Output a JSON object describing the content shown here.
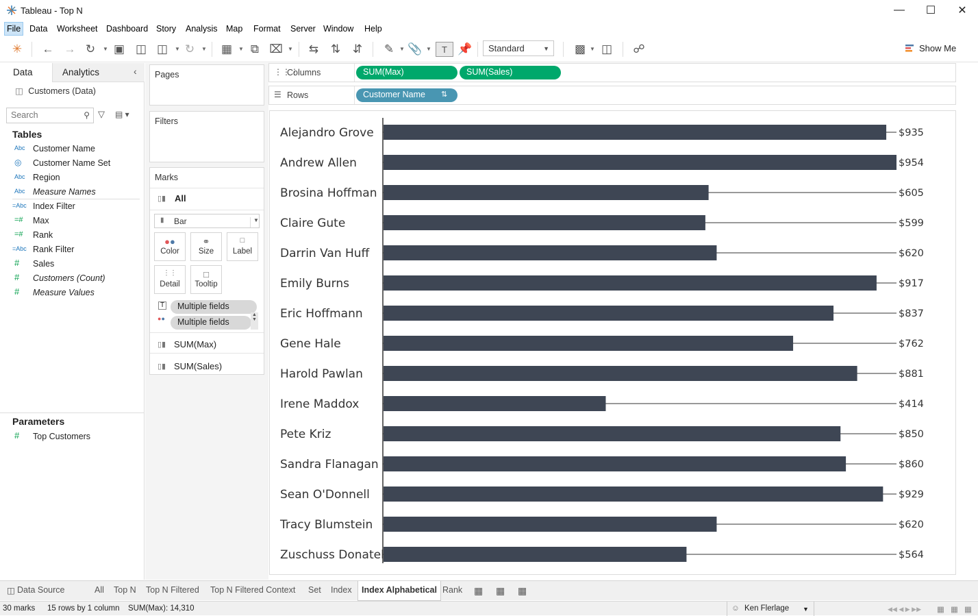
{
  "window": {
    "title": "Tableau - Top N"
  },
  "menu": [
    "File",
    "Data",
    "Worksheet",
    "Dashboard",
    "Story",
    "Analysis",
    "Map",
    "Format",
    "Server",
    "Window",
    "Help"
  ],
  "toolbar": {
    "fit_value": "Standard",
    "show_me": "Show Me"
  },
  "left": {
    "tab_data": "Data",
    "tab_analytics": "Analytics",
    "datasource": "Customers (Data)",
    "search_placeholder": "Search",
    "tables_header": "Tables",
    "fields": [
      {
        "icon": "Abc",
        "name": "Customer Name",
        "italic": false
      },
      {
        "icon": "set",
        "name": "Customer Name Set",
        "italic": false
      },
      {
        "icon": "Abc",
        "name": "Region",
        "italic": false
      },
      {
        "icon": "Abc",
        "name": "Measure Names",
        "italic": true
      },
      {
        "icon": "=Abc",
        "name": "Index Filter",
        "italic": false
      },
      {
        "icon": "=#",
        "name": "Max",
        "italic": false
      },
      {
        "icon": "=#",
        "name": "Rank",
        "italic": false
      },
      {
        "icon": "=Abc",
        "name": "Rank Filter",
        "italic": false
      },
      {
        "icon": "#",
        "name": "Sales",
        "italic": false
      },
      {
        "icon": "#",
        "name": "Customers (Count)",
        "italic": true
      },
      {
        "icon": "#",
        "name": "Measure Values",
        "italic": true
      }
    ],
    "parameters_header": "Parameters",
    "parameters": [
      {
        "icon": "#",
        "name": "Top Customers"
      }
    ]
  },
  "shelves": {
    "pages": "Pages",
    "filters": "Filters",
    "marks": "Marks",
    "marks_all": "All",
    "mark_type": "Bar",
    "buttons": {
      "color": "Color",
      "size": "Size",
      "label": "Label",
      "detail": "Detail",
      "tooltip": "Tooltip"
    },
    "mark_fields": [
      "Multiple fields",
      "Multiple fields"
    ],
    "measures": [
      "SUM(Max)",
      "SUM(Sales)"
    ],
    "columns_label": "Columns",
    "rows_label": "Rows",
    "columns_pills": [
      "SUM(Max)",
      "SUM(Sales)"
    ],
    "rows_pills": [
      "Customer Name"
    ]
  },
  "chart_data": {
    "type": "bar",
    "categories": [
      "Alejandro Grove",
      "Andrew Allen",
      "Brosina Hoffman",
      "Claire Gute",
      "Darrin Van Huff",
      "Emily Burns",
      "Eric Hoffmann",
      "Gene Hale",
      "Harold Pawlan",
      "Irene Maddox",
      "Pete Kriz",
      "Sandra Flanagan",
      "Sean O'Donnell",
      "Tracy Blumstein",
      "Zuschuss Donatelli"
    ],
    "values": [
      935,
      954,
      605,
      599,
      620,
      917,
      837,
      762,
      881,
      414,
      850,
      860,
      929,
      620,
      564
    ],
    "data_labels": [
      "$935",
      "$954",
      "$605",
      "$599",
      "$620",
      "$917",
      "$837",
      "$762",
      "$881",
      "$414",
      "$850",
      "$860",
      "$929",
      "$620",
      "$564"
    ],
    "max_line": 954,
    "bar_color": "#3e4654",
    "orientation": "horizontal"
  },
  "tabs": [
    "Data Source",
    "All",
    "Top N",
    "Top N Filtered",
    "Top N Filtered Context",
    "Set",
    "Index",
    "Index Alphabetical",
    "Rank"
  ],
  "active_tab": "Index Alphabetical",
  "status": {
    "marks": "30 marks",
    "rows": "15 rows by 1 column",
    "sum": "SUM(Max): 14,310",
    "user": "Ken Flerlage"
  }
}
